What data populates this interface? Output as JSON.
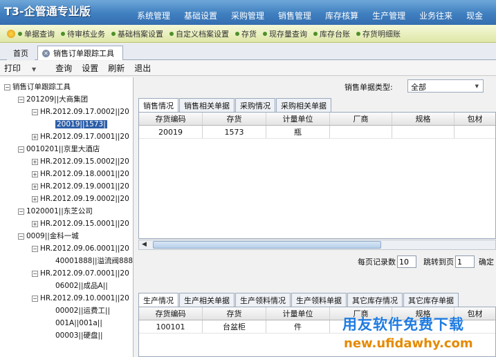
{
  "app": {
    "title": "T3-企管通专业版",
    "menu": [
      "系统管理",
      "基础设置",
      "采购管理",
      "销售管理",
      "库存核算",
      "生产管理",
      "业务往来",
      "现金"
    ]
  },
  "quickbar": {
    "items": [
      "单据查询",
      "待审核业务",
      "基础档案设置",
      "自定义档案设置",
      "存货",
      "现存量查询",
      "库存台账",
      "存货明细账"
    ]
  },
  "tabs": {
    "home": "首页",
    "active": "销售订单跟踪工具"
  },
  "toolbar": {
    "print": "打印",
    "query": "查询",
    "settings": "设置",
    "refresh": "刷新",
    "exit": "退出"
  },
  "tree": {
    "root": "销售订单跟踪工具",
    "nodes": [
      {
        "label": "201209||大商集团",
        "box": "−"
      },
      {
        "label": "HR.2012.09.17.0002||20",
        "box": "−"
      },
      {
        "label": "20019||1573|",
        "box": ""
      },
      {
        "label": "HR.2012.09.17.0001||20",
        "box": "+"
      },
      {
        "label": "0010201||京里大酒店",
        "box": "−"
      },
      {
        "label": "HR.2012.09.15.0002||20",
        "box": "+"
      },
      {
        "label": "HR.2012.09.18.0001||20",
        "box": "+"
      },
      {
        "label": "HR.2012.09.19.0001||20",
        "box": "+"
      },
      {
        "label": "HR.2012.09.19.0002||20",
        "box": "+"
      },
      {
        "label": "1020001||东芝公司",
        "box": "−"
      },
      {
        "label": "HR.2012.09.15.0001||20",
        "box": "+"
      },
      {
        "label": "0009||金科一城",
        "box": "−"
      },
      {
        "label": "HR.2012.09.06.0001||20",
        "box": "−"
      },
      {
        "label": "40001888||溢流阀888",
        "box": ""
      },
      {
        "label": "HR.2012.09.07.0001||20",
        "box": "−"
      },
      {
        "label": "06002||成品A||",
        "box": ""
      },
      {
        "label": "HR.2012.09.10.0001||20",
        "box": "−"
      },
      {
        "label": "00002||运费工||",
        "box": ""
      },
      {
        "label": "001A||001a||",
        "box": ""
      },
      {
        "label": "00003||硬盘||",
        "box": ""
      }
    ]
  },
  "filter": {
    "label": "销售单据类型:",
    "value": "全部"
  },
  "upper": {
    "tabs": [
      "销售情况",
      "销售相关单据",
      "采购情况",
      "采购相关单据"
    ],
    "columns": [
      "存货编码",
      "存货",
      "计量单位",
      "厂商",
      "规格",
      "包材"
    ],
    "rows": [
      [
        "20019",
        "1573",
        "瓶",
        "",
        "",
        ""
      ]
    ]
  },
  "pager": {
    "per_page_label": "每页记录数",
    "per_page_value": "10",
    "goto_label": "跳转到页",
    "goto_value": "1",
    "confirm": "确定"
  },
  "lower": {
    "tabs": [
      "生产情况",
      "生产相关单据",
      "生产领料情况",
      "生产领料单据",
      "其它库存情况",
      "其它库存单据"
    ],
    "columns": [
      "存货编码",
      "存货",
      "计量单位",
      "厂商",
      "规格",
      "包材"
    ],
    "rows": [
      [
        "100101",
        "台盆柜",
        "件",
        "",
        "",
        ""
      ]
    ]
  },
  "watermark": {
    "line1": "用友软件免费下载",
    "line2": "new.ufidawhy.com"
  }
}
